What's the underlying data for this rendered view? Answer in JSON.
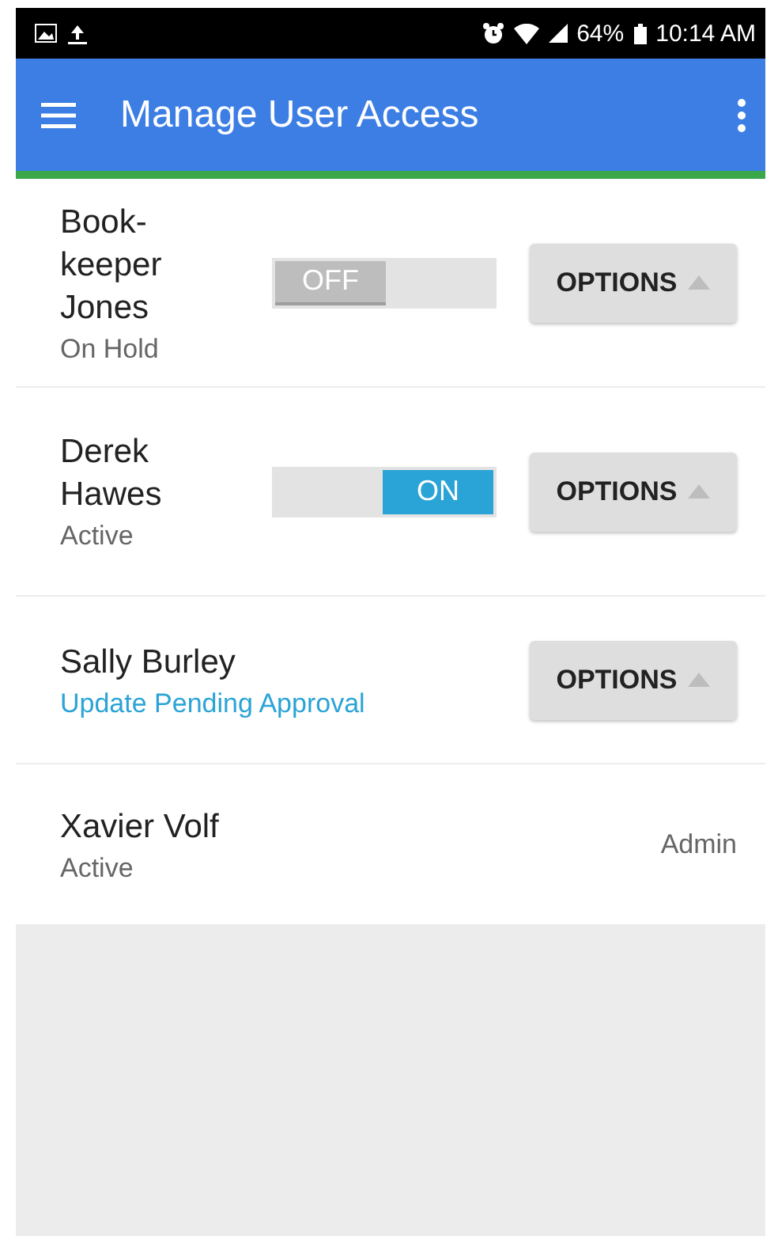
{
  "status_bar": {
    "battery": "64%",
    "time": "10:14 AM"
  },
  "app_bar": {
    "title": "Manage User Access"
  },
  "users": [
    {
      "name": "Book-keeper Jones",
      "status": "On Hold",
      "status_highlight": false,
      "kind": "toggle",
      "toggle": {
        "on": false,
        "label": "OFF"
      },
      "button": "OPTIONS"
    },
    {
      "name": "Derek Hawes",
      "status": "Active",
      "status_highlight": false,
      "kind": "toggle",
      "toggle": {
        "on": true,
        "label": "ON"
      },
      "button": "OPTIONS"
    },
    {
      "name": "Sally Burley",
      "status": "Update Pending Approval",
      "status_highlight": true,
      "kind": "options",
      "button": "OPTIONS"
    },
    {
      "name": "Xavier Volf",
      "status": "Active",
      "status_highlight": false,
      "kind": "role",
      "role": "Admin"
    }
  ]
}
